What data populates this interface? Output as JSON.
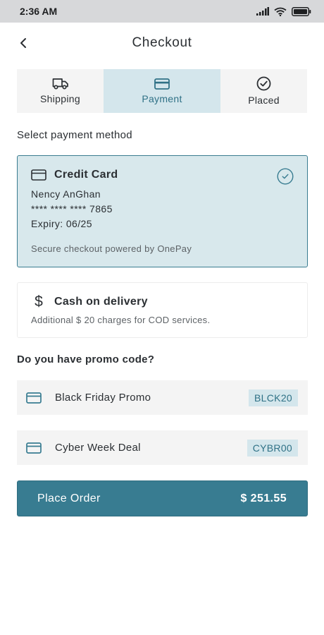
{
  "status_bar": {
    "time": "2:36 AM"
  },
  "header": {
    "title": "Checkout"
  },
  "steps": [
    {
      "label": "Shipping",
      "icon": "truck-icon",
      "active": false
    },
    {
      "label": "Payment",
      "icon": "credit-card-icon",
      "active": true
    },
    {
      "label": "Placed",
      "icon": "check-circle-icon",
      "active": false
    }
  ],
  "payment": {
    "section_label": "Select payment method",
    "credit_card": {
      "title": "Credit Card",
      "holder": "Nency AnGhan",
      "number": "**** **** **** 7865",
      "expiry": "Expiry: 06/25",
      "note": "Secure checkout powered by OnePay",
      "selected": true
    },
    "cod": {
      "title": "Cash on delivery",
      "note": "Additional $ 20 charges for COD services."
    }
  },
  "promo": {
    "section_label": "Do you have promo code?",
    "items": [
      {
        "label": "Black Friday Promo",
        "code": "BLCK20"
      },
      {
        "label": "Cyber Week Deal",
        "code": "CYBR00"
      }
    ]
  },
  "place_order": {
    "label": "Place Order",
    "amount": "$ 251.55"
  },
  "colors": {
    "accent": "#387c91",
    "accent_light": "#d4e6ec",
    "selected_bg": "#d8e8ec",
    "status_bar": "#d7d8da"
  }
}
